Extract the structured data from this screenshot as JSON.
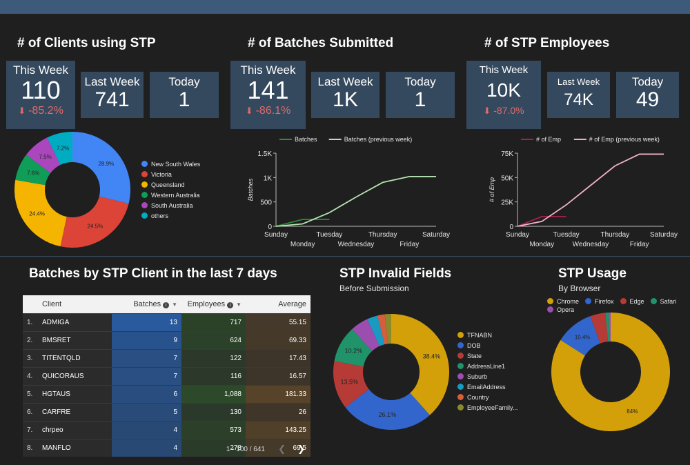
{
  "colors": {
    "blue": "#4285f4",
    "red": "#db4437",
    "yellow": "#f4b400",
    "green": "#0f9d58",
    "purple": "#ab47bc",
    "cyan": "#00acc1",
    "gold": "#d4a00a",
    "teal": "#21936b",
    "kpi_bg": "#35495e",
    "negative": "#e06b6b"
  },
  "clients_section": {
    "title": "# of Clients using STP",
    "this_week_label": "This Week",
    "this_week_value": "110",
    "this_week_change": "-85.2%",
    "last_week_label": "Last Week",
    "last_week_value": "741",
    "today_label": "Today",
    "today_value": "1"
  },
  "batches_section": {
    "title": "# of Batches Submitted",
    "this_week_label": "This Week",
    "this_week_value": "141",
    "this_week_change": "-86.1%",
    "last_week_label": "Last Week",
    "last_week_value": "1K",
    "today_label": "Today",
    "today_value": "1"
  },
  "employees_section": {
    "title": "# of STP Employees",
    "this_week_label": "This Week",
    "this_week_value": "10K",
    "this_week_change": "-87.0%",
    "last_week_label": "Last Week",
    "last_week_value": "74K",
    "today_label": "Today",
    "today_value": "49"
  },
  "table_section": {
    "title": "Batches by STP Client in the last 7 days",
    "columns": [
      "Client",
      "Batches",
      "Employees",
      "Average"
    ],
    "rows": [
      {
        "idx": "1.",
        "client": "ADMIGA",
        "batches": "13",
        "employees": "717",
        "average": "55.15"
      },
      {
        "idx": "2.",
        "client": "BMSRET",
        "batches": "9",
        "employees": "624",
        "average": "69.33"
      },
      {
        "idx": "3.",
        "client": "TITENTQLD",
        "batches": "7",
        "employees": "122",
        "average": "17.43"
      },
      {
        "idx": "4.",
        "client": "QUICORAUS",
        "batches": "7",
        "employees": "116",
        "average": "16.57"
      },
      {
        "idx": "5.",
        "client": "HGTAUS",
        "batches": "6",
        "employees": "1,088",
        "average": "181.33"
      },
      {
        "idx": "6.",
        "client": "CARFRE",
        "batches": "5",
        "employees": "130",
        "average": "26"
      },
      {
        "idx": "7.",
        "client": "chrpeo",
        "batches": "4",
        "employees": "573",
        "average": "143.25"
      },
      {
        "idx": "8.",
        "client": "MANFLO",
        "batches": "4",
        "employees": "278",
        "average": "69.5"
      }
    ],
    "pagination": "1 - 100 / 641"
  },
  "invalid_section": {
    "title": "STP Invalid Fields",
    "subtitle": "Before Submission"
  },
  "usage_section": {
    "title": "STP Usage",
    "subtitle": "By Browser"
  },
  "chart_data": [
    {
      "id": "clients_by_state",
      "type": "pie",
      "categories": [
        "New South Wales",
        "Victoria",
        "Queensland",
        "Western Australia",
        "South Australia",
        "others"
      ],
      "values": [
        28.9,
        24.5,
        24.4,
        7.6,
        7.5,
        7.2
      ],
      "labels": [
        "28.9%",
        "24.5%",
        "24.4%",
        "7.6%",
        "7.5%",
        "7.2%"
      ],
      "colors": [
        "#4285f4",
        "#db4437",
        "#f4b400",
        "#0f9d58",
        "#ab47bc",
        "#00acc1"
      ],
      "legend": "right"
    },
    {
      "id": "batches_line",
      "type": "line",
      "x": [
        "Sunday",
        "Monday",
        "Tuesday",
        "Wednesday",
        "Thursday",
        "Friday",
        "Saturday"
      ],
      "series": [
        {
          "name": "Batches",
          "values": [
            0,
            141,
            141
          ],
          "color": "#2e8b3a"
        },
        {
          "name": "Batches (previous week)",
          "values": [
            0,
            50,
            280,
            600,
            900,
            1020,
            1020
          ],
          "color": "#b4e3b0"
        }
      ],
      "ylabel": "Batches",
      "ylim": [
        0,
        1500
      ],
      "yticks": [
        "0",
        "500",
        "1K",
        "1.5K"
      ],
      "legend": "top"
    },
    {
      "id": "employees_line",
      "type": "line",
      "x": [
        "Sunday",
        "Monday",
        "Tuesday",
        "Wednesday",
        "Thursday",
        "Friday",
        "Saturday"
      ],
      "series": [
        {
          "name": "# of Emp",
          "values": [
            0,
            10000,
            10000
          ],
          "color": "#a0224f"
        },
        {
          "name": "# of Emp (previous week)",
          "values": [
            0,
            5000,
            22000,
            42000,
            62000,
            74000,
            74000
          ],
          "color": "#f2b3c6"
        }
      ],
      "ylabel": "# of Emp",
      "ylim": [
        0,
        75000
      ],
      "yticks": [
        "0",
        "25K",
        "50K",
        "75K"
      ],
      "legend": "top"
    },
    {
      "id": "invalid_fields",
      "type": "pie",
      "categories": [
        "TFNABN",
        "DOB",
        "State",
        "AddressLine1",
        "Suburb",
        "EmailAddress",
        "Country",
        "EmployeeFamily..."
      ],
      "values": [
        38.4,
        26.1,
        13.5,
        10.2,
        5.0,
        3.0,
        2.0,
        1.8
      ],
      "labels": [
        "38.4%",
        "26.1%",
        "13.5%",
        "10.2%",
        "",
        "",
        "",
        ""
      ],
      "colors": [
        "#d4a00a",
        "#3366cc",
        "#b63a35",
        "#21936b",
        "#9c4db0",
        "#1a9ac0",
        "#d55e3c",
        "#8a8a2b"
      ],
      "legend": "right"
    },
    {
      "id": "browser_usage",
      "type": "pie",
      "categories": [
        "Chrome",
        "Firefox",
        "Edge",
        "Safari",
        "Opera"
      ],
      "values": [
        84,
        10.4,
        4.2,
        0.9,
        0.5
      ],
      "labels": [
        "84%",
        "10.4%",
        "",
        "",
        ""
      ],
      "colors": [
        "#d4a00a",
        "#3366cc",
        "#b63a35",
        "#21936b",
        "#9c4db0"
      ],
      "legend": "top"
    }
  ]
}
